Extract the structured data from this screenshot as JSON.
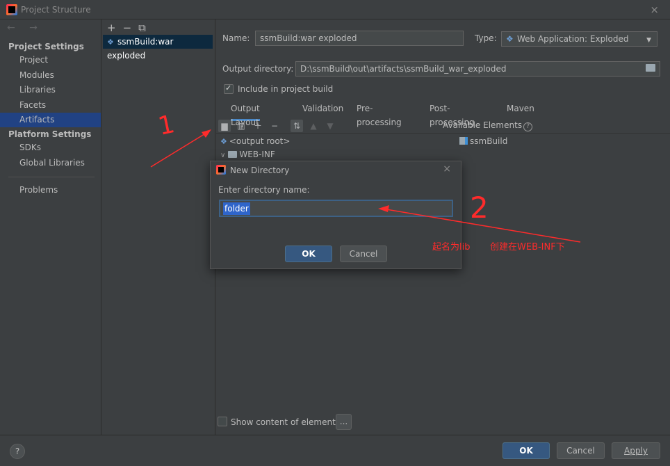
{
  "window": {
    "title": "Project Structure",
    "close_glyph": "×"
  },
  "nav": {
    "back_forward": "← →"
  },
  "sidebar": {
    "project_settings_header": "Project Settings",
    "project_items": [
      {
        "label": "Project"
      },
      {
        "label": "Modules"
      },
      {
        "label": "Libraries"
      },
      {
        "label": "Facets"
      },
      {
        "label": "Artifacts",
        "selected": true
      }
    ],
    "platform_settings_header": "Platform Settings",
    "platform_items": [
      {
        "label": "SDKs"
      },
      {
        "label": "Global Libraries"
      }
    ],
    "problems_label": "Problems"
  },
  "artifacts_list": {
    "toolbar": {
      "add": "+",
      "remove": "−",
      "copy": "⧉"
    },
    "items": [
      {
        "label": "ssmBuild:war exploded"
      }
    ]
  },
  "detail": {
    "name_label": "Name:",
    "name_value": "ssmBuild:war exploded",
    "type_label": "Type:",
    "type_value": "Web Application: Exploded",
    "output_dir_label": "Output directory:",
    "output_dir_value": "D:\\ssmBuild\\out\\artifacts\\ssmBuild_war_exploded",
    "include_build_label": "Include in project build",
    "include_build_checked": true,
    "tabs": [
      {
        "label": "Output Layout",
        "active": true
      },
      {
        "label": "Validation"
      },
      {
        "label": "Pre-processing"
      },
      {
        "label": "Post-processing"
      },
      {
        "label": "Maven"
      }
    ],
    "available_elements_label": "Available Elements",
    "tree": [
      {
        "label": "<output root>"
      },
      {
        "label": "WEB-INF"
      }
    ],
    "available_items": [
      {
        "label": "ssmBuild"
      }
    ],
    "show_content_label": "Show content of elements",
    "show_content_checked": false,
    "ellipsis_button": "..."
  },
  "dialog": {
    "title": "New Directory",
    "close_glyph": "×",
    "prompt": "Enter directory name:",
    "input_value": "folder",
    "ok_label": "OK",
    "cancel_label": "Cancel"
  },
  "footer": {
    "help": "?",
    "ok_label": "OK",
    "cancel_label": "Cancel",
    "apply_label": "Apply"
  },
  "annotations": {
    "mark_1": "1",
    "mark_2": "2",
    "note": "起名为lib",
    "note2": "创建在WEB-INF下",
    "color": "#ff2b2b"
  }
}
